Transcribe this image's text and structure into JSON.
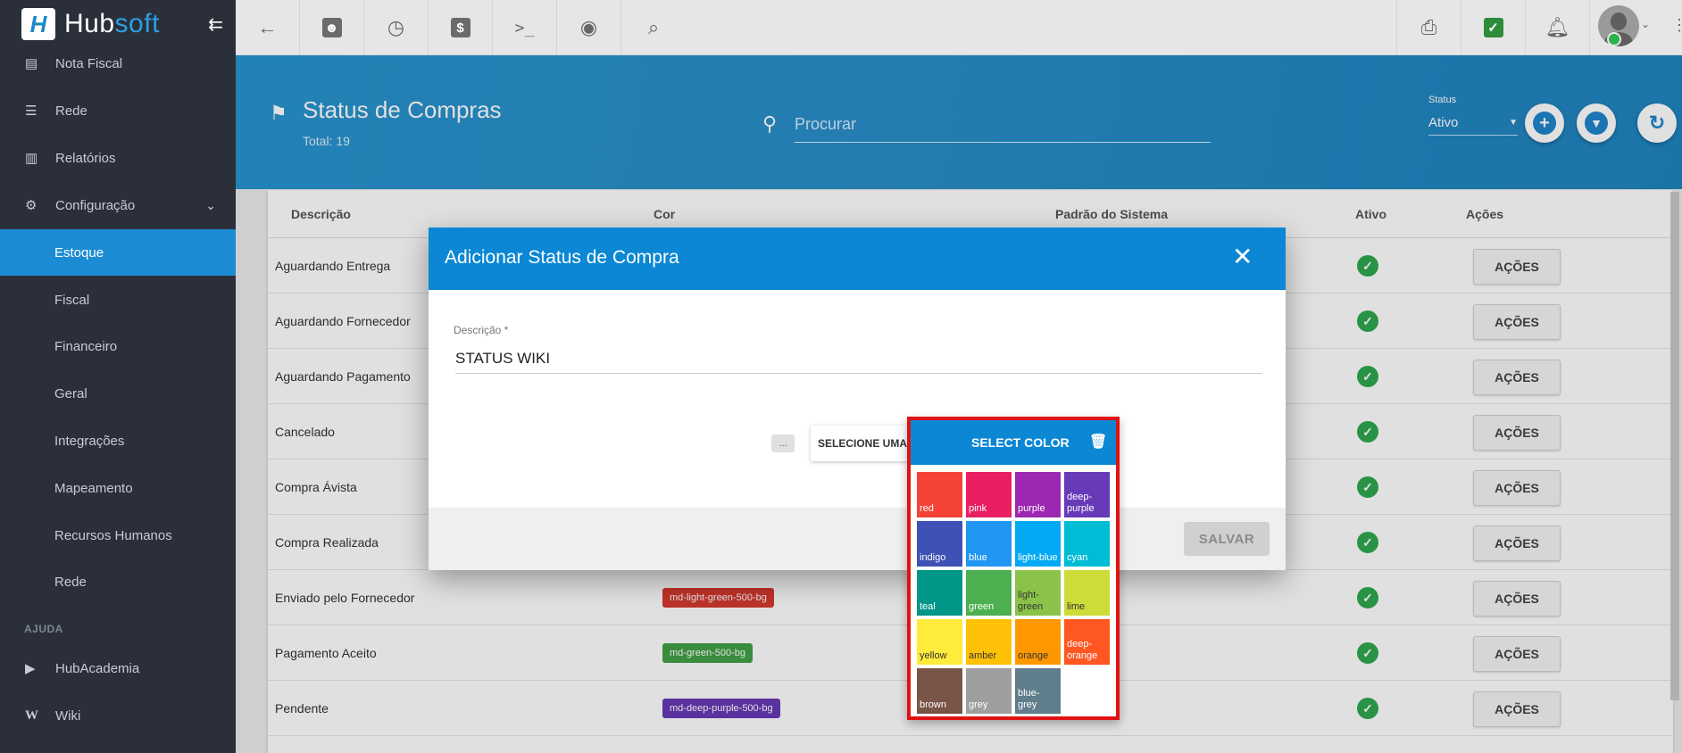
{
  "app": {
    "brand_prefix": "Hub",
    "brand_suffix": "soft",
    "collapse_icon": "menu-collapse-icon"
  },
  "sidebar": {
    "items": [
      {
        "label": "Nota Fiscal",
        "icon": "file-icon"
      },
      {
        "label": "Rede",
        "icon": "server-icon"
      },
      {
        "label": "Relatórios",
        "icon": "report-icon"
      },
      {
        "label": "Configuração",
        "icon": "gear-icon"
      },
      {
        "label": "Estoque"
      },
      {
        "label": "Fiscal"
      },
      {
        "label": "Financeiro"
      },
      {
        "label": "Geral"
      },
      {
        "label": "Integrações"
      },
      {
        "label": "Mapeamento"
      },
      {
        "label": "Recursos Humanos"
      },
      {
        "label": "Rede"
      },
      {
        "label": "HubAcademia",
        "icon": "youtube-icon"
      },
      {
        "label": "Wiki",
        "icon": "wikipedia-icon"
      }
    ],
    "section_ajuda": "AJUDA"
  },
  "topbar": {
    "icons": [
      "back-arrow-icon",
      "contact-card-icon",
      "calendar-clock-icon",
      "dollar-icon",
      "terminal-icon",
      "eye-icon",
      "search-icon",
      "pdf-icon",
      "chat-check-icon",
      "bell-icon"
    ]
  },
  "page": {
    "title": "Status de Compras",
    "total": "Total: 19",
    "search_placeholder": "Procurar",
    "status_label": "Status",
    "status_value": "Ativo"
  },
  "table": {
    "columns": [
      "Descrição",
      "Cor",
      "Padrão do Sistema",
      "Ativo",
      "Ações"
    ],
    "rows": [
      {
        "descricao": "Aguardando Entrega",
        "cor": "",
        "acoes": "AÇÕES"
      },
      {
        "descricao": "Aguardando Fornecedor",
        "cor": "",
        "acoes": "AÇÕES"
      },
      {
        "descricao": "Aguardando Pagamento",
        "cor": "",
        "acoes": "AÇÕES"
      },
      {
        "descricao": "Cancelado",
        "cor": "",
        "acoes": "AÇÕES"
      },
      {
        "descricao": "Compra Ávista",
        "cor": "",
        "acoes": "AÇÕES"
      },
      {
        "descricao": "Compra Realizada",
        "cor": "",
        "acoes": "AÇÕES"
      },
      {
        "descricao": "Enviado pelo Fornecedor",
        "cor": "md-light-green-500-bg",
        "cor_hex": "#d63a2e",
        "acoes": "AÇÕES"
      },
      {
        "descricao": "Pagamento Aceito",
        "cor": "md-green-500-bg",
        "cor_hex": "#4caf50",
        "acoes": "AÇÕES"
      },
      {
        "descricao": "Pendente",
        "cor": "md-deep-purple-500-bg",
        "cor_hex": "#673ab7",
        "acoes": "AÇÕES"
      }
    ]
  },
  "modal": {
    "title": "Adicionar Status de Compra",
    "descricao_label": "Descrição *",
    "descricao_value": "STATUS WIKI",
    "dots_label": "...",
    "select_color_button": "SELECIONE UMA",
    "salvar": "SALVAR"
  },
  "picker": {
    "title": "SELECT COLOR",
    "colors": [
      {
        "name": "red",
        "hex": "#f44336"
      },
      {
        "name": "pink",
        "hex": "#e91e63"
      },
      {
        "name": "purple",
        "hex": "#9c27b0"
      },
      {
        "name": "deep-purple",
        "hex": "#673ab7"
      },
      {
        "name": "indigo",
        "hex": "#3f51b5"
      },
      {
        "name": "blue",
        "hex": "#2196f3"
      },
      {
        "name": "light-blue",
        "hex": "#03a9f4"
      },
      {
        "name": "cyan",
        "hex": "#00bcd4"
      },
      {
        "name": "teal",
        "hex": "#009688"
      },
      {
        "name": "green",
        "hex": "#4caf50"
      },
      {
        "name": "light-green",
        "hex": "#8bc34a"
      },
      {
        "name": "lime",
        "hex": "#cddc39"
      },
      {
        "name": "yellow",
        "hex": "#ffeb3b"
      },
      {
        "name": "amber",
        "hex": "#ffc107"
      },
      {
        "name": "orange",
        "hex": "#ff9800"
      },
      {
        "name": "deep-orange",
        "hex": "#ff5722"
      },
      {
        "name": "brown",
        "hex": "#795548"
      },
      {
        "name": "grey",
        "hex": "#9e9e9e"
      },
      {
        "name": "blue-grey",
        "hex": "#607d8b"
      }
    ]
  }
}
